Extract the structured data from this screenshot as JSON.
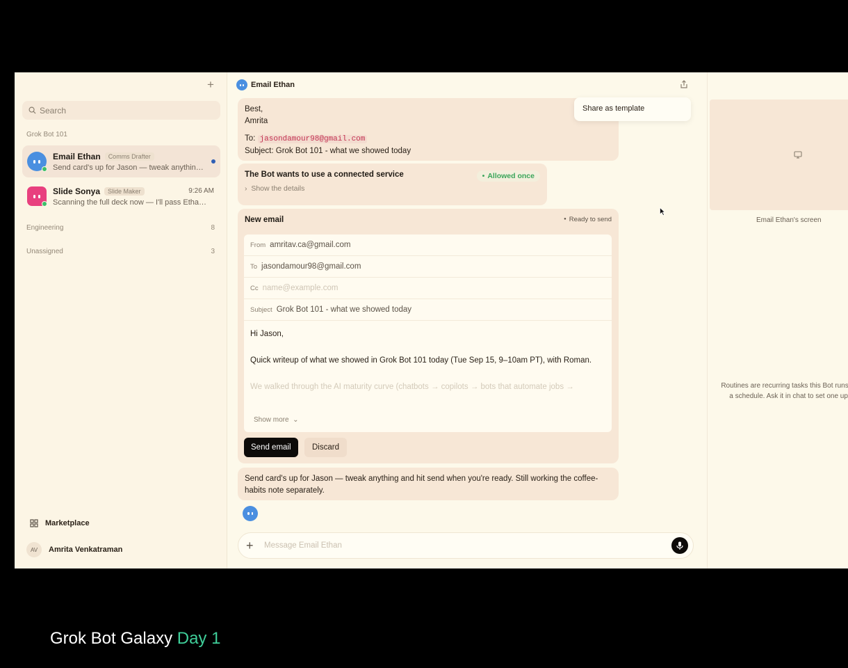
{
  "sidebar": {
    "search_placeholder": "Search",
    "groups": [
      {
        "label": "Grok Bot 101"
      },
      {
        "label": "Engineering",
        "count": "8"
      },
      {
        "label": "Unassigned",
        "count": "3"
      }
    ],
    "conversations": [
      {
        "name": "Email Ethan",
        "tag": "Comms Drafter",
        "time": "",
        "preview": "Send card's up for Jason — tweak anything and hit send when you're ready.",
        "avatar_color": "#4a8fe0"
      },
      {
        "name": "Slide Sonya",
        "tag": "Slide Maker",
        "time": "9:26 AM",
        "preview": "Scanning the full deck now — I'll pass Ethan the highlights.",
        "avatar_color": "#e8407e"
      }
    ],
    "marketplace_label": "Marketplace",
    "user_initials": "AV",
    "user_name": "Amrita Venkatraman"
  },
  "chat": {
    "title": "Email Ethan",
    "menu_item": "Share as template",
    "msg1": {
      "line1": "Best,",
      "line2": "Amrita",
      "to_label": "To:",
      "to_email": "jasondamour98@gmail.com",
      "subject_line": "Subject: Grok Bot 101 - what we showed today"
    },
    "service": {
      "title": "The Bot wants to use a connected service",
      "status": "Allowed once",
      "details": "Show the details"
    },
    "new_email": {
      "title": "New email",
      "status": "Ready to send",
      "from_label": "From",
      "from": "amritav.ca@gmail.com",
      "to_label": "To",
      "to": "jasondamour98@gmail.com",
      "cc_label": "Cc",
      "cc_placeholder": "name@example.com",
      "subject_label": "Subject",
      "subject": "Grok Bot 101 - what we showed today",
      "greeting": "Hi Jason,",
      "para1": "Quick writeup of what we showed in Grok Bot 101 today (Tue Sep 15, 9–10am PT), with Roman.",
      "para2": "We walked through the AI maturity curve (chatbots → copilots → bots that automate jobs →",
      "show_more": "Show more",
      "send_label": "Send email",
      "discard_label": "Discard"
    },
    "msg4": "Send card's up for Jason — tweak anything and hit send when you're ready. Still working the coffee-habits note separately.",
    "composer_placeholder": "Message Email Ethan"
  },
  "right_panel": {
    "screen_label": "Email Ethan's screen",
    "routines_text": "Routines are recurring tasks this Bot runs on a schedule. Ask it in chat to set one up."
  },
  "caption": {
    "main": "Grok Bot Galaxy",
    "accent": "Day 1",
    "accent_color": "#3fcf9a"
  }
}
